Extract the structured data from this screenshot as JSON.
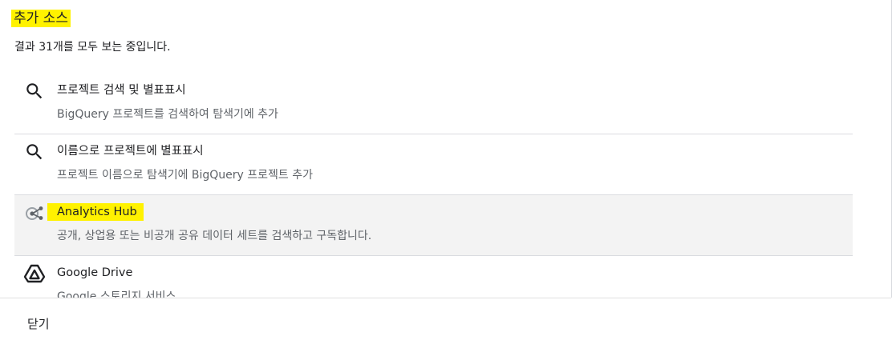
{
  "dialog": {
    "title": "추가 소스",
    "subtitle": "결과 31개를 모두 보는 중입니다."
  },
  "items": [
    {
      "icon": "search-icon",
      "title": "프로젝트 검색 및 별표표시",
      "desc": "BigQuery 프로젝트를 검색하여 탐색기에 추가"
    },
    {
      "icon": "search-icon",
      "title": "이름으로 프로젝트에 별표표시",
      "desc": "프로젝트 이름으로 탐색기에 BigQuery 프로젝트 추가"
    },
    {
      "icon": "analytics-hub-icon",
      "title": "Analytics Hub",
      "desc": "공개, 상업용 또는 비공개 공유 데이터 세트를 검색하고 구독합니다."
    },
    {
      "icon": "google-drive-icon",
      "title": "Google Drive",
      "desc": "Google 스토리지 서비스"
    }
  ],
  "footer": {
    "close_label": "닫기"
  },
  "colors": {
    "highlight": "#fff200",
    "selected_bg": "#f3f3f3",
    "divider": "#dadce0"
  }
}
